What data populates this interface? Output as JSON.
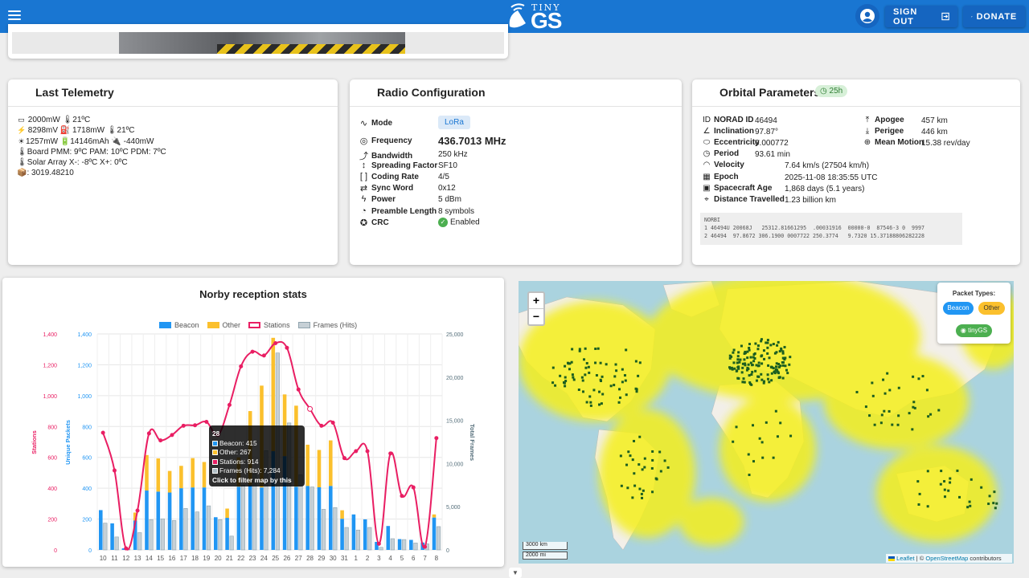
{
  "header": {
    "logo_small": "TINY",
    "logo_big": "GS",
    "signout_label": "SIGN OUT",
    "donate_label": "DONATE",
    "icons": [
      "menu-icon",
      "satellite-dish-icon",
      "account-icon",
      "logout-icon",
      "paypal-icon"
    ]
  },
  "telemetry": {
    "title": "Last Telemetry",
    "lines": [
      "2000mW 🌡21ºC",
      "8298mV ⛽ 1718mW 🌡21ºC",
      "1257mW 🔋14146mAh 🔌 -440mW",
      "🌡Board PMM: 9ºC PAM: 10ºC PDM: 7ºC",
      "🌡Solar Array X-: -8ºC X+: 0ºC",
      "📦: 3019.48210"
    ]
  },
  "radio": {
    "title": "Radio Configuration",
    "mode_label": "Mode",
    "mode_value": "LoRa",
    "frequency_label": "Frequency",
    "frequency_value": "436.7013 MHz",
    "rows": [
      {
        "label": "Bandwidth",
        "value": "250 kHz"
      },
      {
        "label": "Spreading Factor",
        "value": "SF10"
      },
      {
        "label": "Coding Rate",
        "value": "4/5"
      },
      {
        "label": "Sync Word",
        "value": "0x12"
      },
      {
        "label": "Power",
        "value": "5 dBm"
      },
      {
        "label": "Preamble Length",
        "value": "8 symbols"
      }
    ],
    "crc_label": "CRC",
    "crc_value": "Enabled"
  },
  "orbital": {
    "title": "Orbital Parameters",
    "badge": "25h",
    "left_rows": [
      {
        "label": "NORAD ID",
        "value": "46494"
      },
      {
        "label": "Inclination",
        "value": "97.87°"
      },
      {
        "label": "Eccentricity",
        "value": "0.000772"
      },
      {
        "label": "Period",
        "value": "93.61 min"
      },
      {
        "label": "Velocity",
        "value": "7.64 km/s (27504 km/h)"
      },
      {
        "label": "Epoch",
        "value": "2025-11-08 18:35:55 UTC"
      },
      {
        "label": "Spacecraft Age",
        "value": "1,868 days (5.1 years)"
      },
      {
        "label": "Distance Travelled",
        "value": "1.23 billion km"
      }
    ],
    "right_rows": [
      {
        "label": "Apogee",
        "value": "457 km"
      },
      {
        "label": "Perigee",
        "value": "446 km"
      },
      {
        "label": "Mean Motion",
        "value": "15.38 rev/day"
      }
    ],
    "tle": [
      "NORBI",
      "1 46494U 20068J   25312.81661295  .00031916  00000-0  87546-3 0  9997",
      "2 46494  97.8672 306.1900 0007722 250.3774   9.7320 15.37188806282228"
    ]
  },
  "chart_data": {
    "type": "bar",
    "title": "Norby reception stats",
    "categories": [
      "10",
      "11",
      "12",
      "13",
      "14",
      "15",
      "16",
      "17",
      "18",
      "19",
      "20",
      "21",
      "22",
      "23",
      "24",
      "25",
      "26",
      "27",
      "28",
      "29",
      "30",
      "31",
      "1",
      "2",
      "3",
      "4",
      "5",
      "6",
      "7",
      "8"
    ],
    "series": [
      {
        "name": "Beacon",
        "type": "bar",
        "axis": "left",
        "color": "#2196f3",
        "stack": "packets",
        "values": [
          258,
          172,
          10,
          190,
          385,
          378,
          372,
          400,
          405,
          405,
          212,
          208,
          410,
          420,
          405,
          640,
          608,
          410,
          415,
          406,
          415,
          202,
          230,
          198,
          52,
          155,
          70,
          65,
          48,
          210
        ]
      },
      {
        "name": "Other",
        "type": "bar",
        "axis": "left",
        "color": "#fbc02d",
        "stack": "packets",
        "values": [
          0,
          0,
          0,
          52,
          230,
          215,
          140,
          145,
          190,
          165,
          0,
          60,
          190,
          480,
          660,
          735,
          400,
          525,
          267,
          242,
          295,
          55,
          0,
          0,
          0,
          0,
          0,
          0,
          0,
          20
        ]
      },
      {
        "name": "Stations",
        "type": "line",
        "axis": "stations",
        "color": "#e91e63",
        "values": [
          760,
          515,
          10,
          255,
          755,
          710,
          745,
          805,
          808,
          830,
          745,
          940,
          1190,
          1285,
          1260,
          1340,
          1310,
          1040,
          914,
          805,
          825,
          595,
          640,
          640,
          40,
          625,
          350,
          405,
          20,
          725
        ]
      },
      {
        "name": "Frames (Hits)",
        "type": "bar",
        "axis": "right",
        "color": "#b0bec5",
        "values": [
          3100,
          1500,
          100,
          2000,
          3500,
          3600,
          3400,
          4800,
          4400,
          5100,
          3500,
          1600,
          7500,
          8800,
          11500,
          22800,
          14700,
          8700,
          7284,
          4700,
          4900,
          2600,
          2300,
          2600,
          300,
          1300,
          1200,
          800,
          700,
          2700
        ]
      }
    ],
    "axes": {
      "stations": {
        "title": "Stations",
        "ticks": [
          "0",
          "200",
          "400",
          "600",
          "800",
          "1,000",
          "1,200",
          "1,400"
        ],
        "max": 1400
      },
      "left": {
        "title": "Unique Packets",
        "ticks": [
          "0",
          "200",
          "400",
          "600",
          "800",
          "1,000",
          "1,200",
          "1,400"
        ],
        "max": 1400
      },
      "right": {
        "title": "Total Frames",
        "ticks": [
          "0",
          "5,000",
          "10,000",
          "15,000",
          "20,000",
          "25,000"
        ],
        "max": 25000
      }
    },
    "colors": {
      "stations_axis": "#e91e63",
      "left_axis": "#2196f3",
      "right_axis": "#546e7a"
    }
  },
  "tooltip": {
    "day": "28",
    "beacon": "Beacon: 415",
    "other": "Other: 267",
    "stations": "Stations: 914",
    "frames": "Frames (Hits): 7,284",
    "hint": "Click to filter map by this day"
  },
  "map": {
    "zoom_in": "+",
    "zoom_out": "−",
    "packet_types_title": "Packet Types:",
    "beacon_pill": "Beacon",
    "other_pill": "Other",
    "tinygs_pill": "tinyGS",
    "scale_km": "3000 km",
    "scale_mi": "2000 mi",
    "attrib_leaflet": "Leaflet",
    "attrib_osm": "OpenStreetMap",
    "attrib_rest": " contributors",
    "attrib_sep": " | © "
  }
}
